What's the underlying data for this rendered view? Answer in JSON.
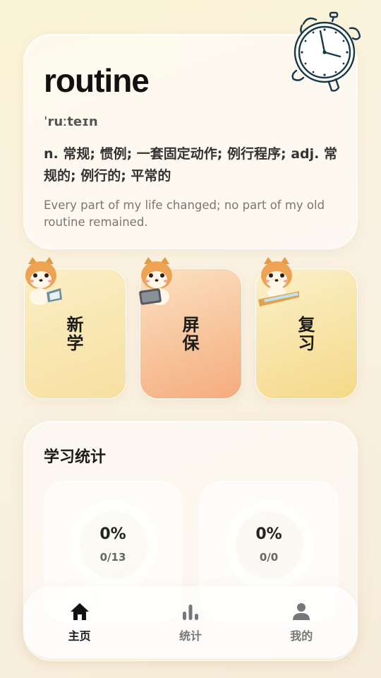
{
  "word": {
    "title": "routine",
    "phonetic": "ˈruːteɪn",
    "meaning": "n. 常规; 惯例; 一套固定动作; 例行程序; adj. 常规的; 例行的; 平常的",
    "example": "Every part of my life changed; no part of my old routine remained."
  },
  "actions": [
    {
      "label": "新学",
      "icon": "dog-reading-icon"
    },
    {
      "label": "屏保",
      "icon": "dog-tablet-icon"
    },
    {
      "label": "复习",
      "icon": "dog-keyboard-icon"
    }
  ],
  "stats": {
    "title": "学习统计",
    "items": [
      {
        "percent": "0%",
        "fraction": "0/13"
      },
      {
        "percent": "0%",
        "fraction": "0/0"
      }
    ]
  },
  "nav": [
    {
      "label": "主页",
      "icon": "home-icon",
      "active": true
    },
    {
      "label": "统计",
      "icon": "bar-chart-icon",
      "active": false
    },
    {
      "label": "我的",
      "icon": "user-icon",
      "active": false
    }
  ],
  "colors": {
    "accent_orange": "#f5ac7d",
    "accent_yellow": "#f5d989",
    "clock_stroke": "#17384a"
  }
}
